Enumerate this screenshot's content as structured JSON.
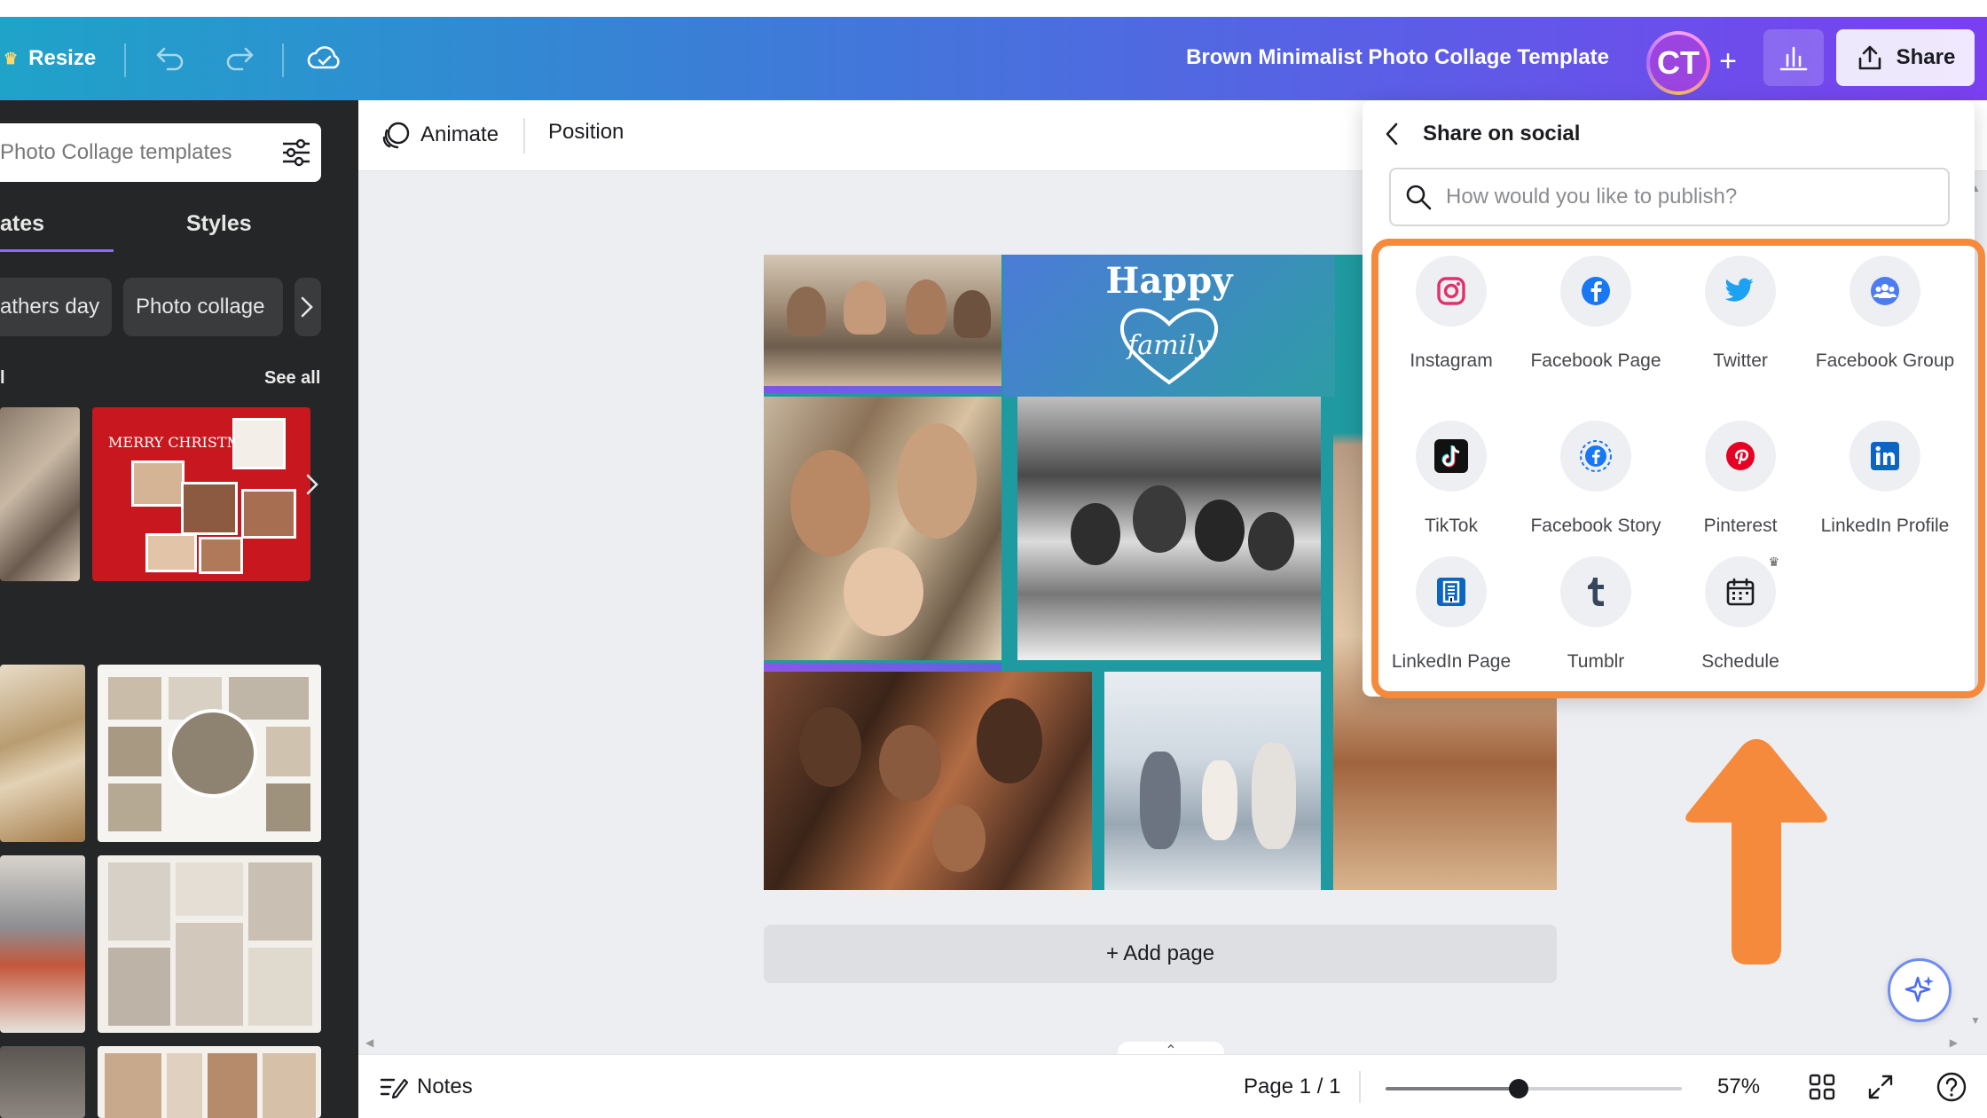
{
  "topbar": {
    "resize_label": "Resize",
    "doc_title": "Brown Minimalist Photo Collage Template",
    "avatar_initials": "CT",
    "share_label": "Share"
  },
  "left_panel": {
    "search_placeholder": "Photo Collage templates",
    "tabs": [
      {
        "label": "ates"
      },
      {
        "label": "Styles"
      }
    ],
    "chips": [
      {
        "label": "athers day"
      },
      {
        "label": "Photo collage"
      }
    ],
    "section_title": "l",
    "see_all_label": "See all",
    "christmas_text": "MERRY CHRISTMAS"
  },
  "subbar": {
    "animate_label": "Animate",
    "position_label": "Position"
  },
  "canvas": {
    "happy_title": "Happy",
    "happy_script": "family",
    "add_page_label": "+ Add page"
  },
  "bottombar": {
    "notes_label": "Notes",
    "page_indicator": "Page 1 / 1",
    "zoom_level": "57%",
    "zoom_fraction": 0.45
  },
  "share_panel": {
    "title": "Share on social",
    "search_placeholder": "How would you like to publish?",
    "options": [
      {
        "label": "Instagram",
        "icon": "instagram-icon"
      },
      {
        "label": "Facebook Page",
        "icon": "facebook-icon"
      },
      {
        "label": "Twitter",
        "icon": "twitter-icon"
      },
      {
        "label": "Facebook Group",
        "icon": "facebook-group-icon"
      },
      {
        "label": "TikTok",
        "icon": "tiktok-icon"
      },
      {
        "label": "Facebook Story",
        "icon": "facebook-story-icon"
      },
      {
        "label": "Pinterest",
        "icon": "pinterest-icon"
      },
      {
        "label": "LinkedIn Profile",
        "icon": "linkedin-icon"
      },
      {
        "label": "LinkedIn Page",
        "icon": "linkedin-page-icon"
      },
      {
        "label": "Tumblr",
        "icon": "tumblr-icon"
      },
      {
        "label": "Schedule",
        "icon": "calendar-icon"
      }
    ]
  },
  "colors": {
    "highlight": "#f68a3c",
    "accent": "#8f6bff",
    "instagram": "#e1306c",
    "facebook": "#1877f2",
    "twitter": "#1da1f2",
    "pinterest": "#e60023",
    "linkedin": "#0a66c2"
  }
}
